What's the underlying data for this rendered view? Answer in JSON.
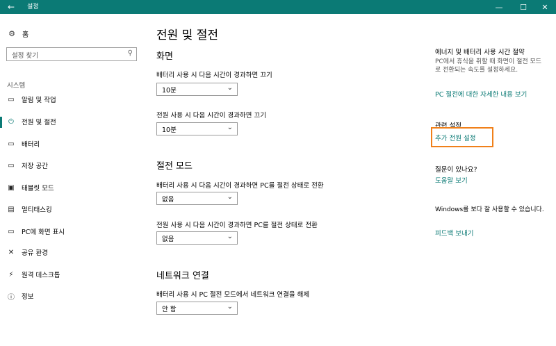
{
  "window": {
    "title": "설정",
    "back_icon": "←",
    "min_icon": "—",
    "max_icon": "☐",
    "close_icon": "✕"
  },
  "sidebar": {
    "home_label": "홈",
    "search_placeholder": "설정 찾기",
    "section_label": "시스템",
    "items": [
      {
        "label": "알림 및 작업",
        "icon": "▭"
      },
      {
        "label": "전원 및 절전",
        "icon": "⏻"
      },
      {
        "label": "배터리",
        "icon": "▭"
      },
      {
        "label": "저장 공간",
        "icon": "▭"
      },
      {
        "label": "태블릿 모드",
        "icon": "▣"
      },
      {
        "label": "멀티태스킹",
        "icon": "▤"
      },
      {
        "label": "PC에 화면 표시",
        "icon": "▭"
      },
      {
        "label": "공유 환경",
        "icon": "✕"
      },
      {
        "label": "원격 데스크톱",
        "icon": "⚡"
      },
      {
        "label": "정보",
        "icon": "ⓘ"
      }
    ],
    "active_index": 1
  },
  "main": {
    "title": "전원 및 절전",
    "screen_heading": "화면",
    "screen_battery_label": "배터리 사용 시 다음 시간이 경과하면 끄기",
    "screen_battery_value": "10분",
    "screen_plugged_label": "전원 사용 시 다음 시간이 경과하면 끄기",
    "screen_plugged_value": "10분",
    "sleep_heading": "절전 모드",
    "sleep_battery_label": "배터리 사용 시 다음 시간이 경과하면 PC를 절전 상태로 전환",
    "sleep_battery_value": "없음",
    "sleep_plugged_label": "전원 사용 시 다음 시간이 경과하면 PC를 절전 상태로 전환",
    "sleep_plugged_value": "없음",
    "network_heading": "네트워크 연결",
    "network_label": "배터리 사용 시 PC 절전 모드에서 네트워크 연결을 해제",
    "network_value": "안 함",
    "chevron": "⌄"
  },
  "right": {
    "energy_heading": "에너지 및 배터리 사용 시간 절약",
    "energy_text": "PC에서 휴식을 취할 때 화면이 절전 모드로 전환되는 속도를 설정하세요.",
    "energy_link": "PC 절전에 대한 자세한 내용 보기",
    "related_heading": "관련 설정",
    "related_link": "추가 전원 설정",
    "question_heading": "질문이 있나요?",
    "help_link": "도움말 보기",
    "improve_text": "Windows를 보다 잘 사용할 수 있습니다.",
    "feedback_link": "피드백 보내기"
  },
  "colors": {
    "accent": "#0b7a75",
    "highlight": "#f0801a"
  }
}
